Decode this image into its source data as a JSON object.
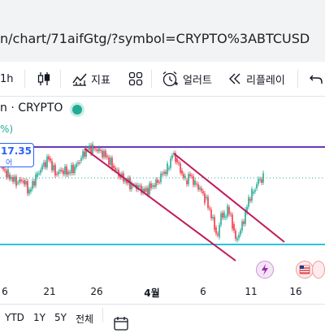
{
  "browser": {
    "url": "n/chart/71aifGtg/?symbol=CRYPTO%3ABTCUSD"
  },
  "toolbar": {
    "interval": "1h",
    "indicators_label": "지표",
    "alert_label": "얼러트",
    "replay_label": "리플레이"
  },
  "chart": {
    "symbol": "n · CRYPTO",
    "change_pct": "%)",
    "price_badge_value": "17.35",
    "price_badge_sub": "어",
    "colors": {
      "up": "#22ab94",
      "down": "#f23645",
      "channel": "#c2185b",
      "resistance": "#673ab7",
      "support": "#26c6da",
      "current_price": "#2962ff"
    }
  },
  "x_axis": {
    "labels": [
      "6",
      "21",
      "26",
      "4월",
      "6",
      "11",
      "16"
    ]
  },
  "bottom_bar": {
    "ranges": [
      "YTD",
      "1Y",
      "5Y",
      "전체"
    ]
  }
}
